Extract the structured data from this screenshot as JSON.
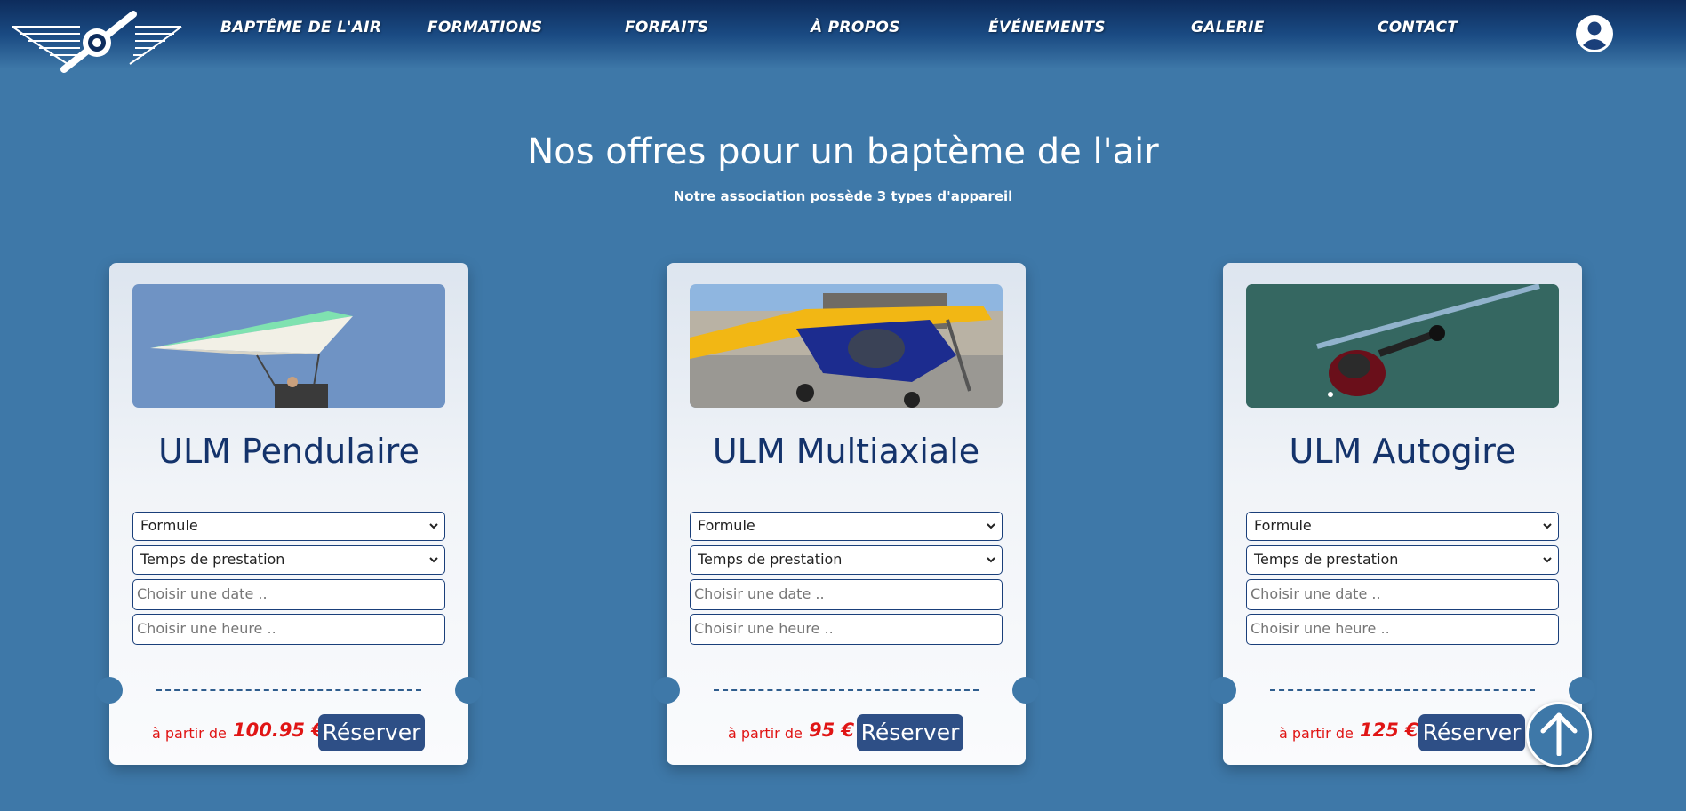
{
  "nav": {
    "items": [
      {
        "label": "BAPTÊME DE L'AIR"
      },
      {
        "label": "FORMATIONS"
      },
      {
        "label": "FORFAITS"
      },
      {
        "label": "À PROPOS"
      },
      {
        "label": "ÉVÉNEMENTS"
      },
      {
        "label": "GALERIE"
      },
      {
        "label": "CONTACT"
      }
    ],
    "account_icon": "user-circle-icon",
    "logo_icon": "winged-propeller-logo"
  },
  "hero": {
    "title": "Nos offres pour un baptème de l'air",
    "subtitle_pre": "Notre association possède ",
    "subtitle_strong": "3 types d'appareil"
  },
  "cards": [
    {
      "title": "ULM Pendulaire",
      "formule": "Formule",
      "temps": "Temps de prestation",
      "date_placeholder": "Choisir une date ..",
      "heure_placeholder": "Choisir une heure ..",
      "price_label": "à partir de",
      "price": "100.95 €",
      "reserve": "Réserver"
    },
    {
      "title": "ULM Multiaxiale",
      "formule": "Formule",
      "temps": "Temps de prestation",
      "date_placeholder": "Choisir une date ..",
      "heure_placeholder": "Choisir une heure ..",
      "price_label": "à partir de",
      "price": "95 €",
      "reserve": "Réserver"
    },
    {
      "title": "ULM Autogire",
      "formule": "Formule",
      "temps": "Temps de prestation",
      "date_placeholder": "Choisir une date ..",
      "heure_placeholder": "Choisir une heure ..",
      "price_label": "à partir de",
      "price": "125 €",
      "reserve": "Réserver"
    }
  ],
  "scroll_top_icon": "arrow-up-icon",
  "colors": {
    "background": "#3e78a8",
    "header_dark": "#0d2c5c",
    "card_title": "#14336b",
    "price": "#e01515",
    "button": "#2e4f86"
  }
}
